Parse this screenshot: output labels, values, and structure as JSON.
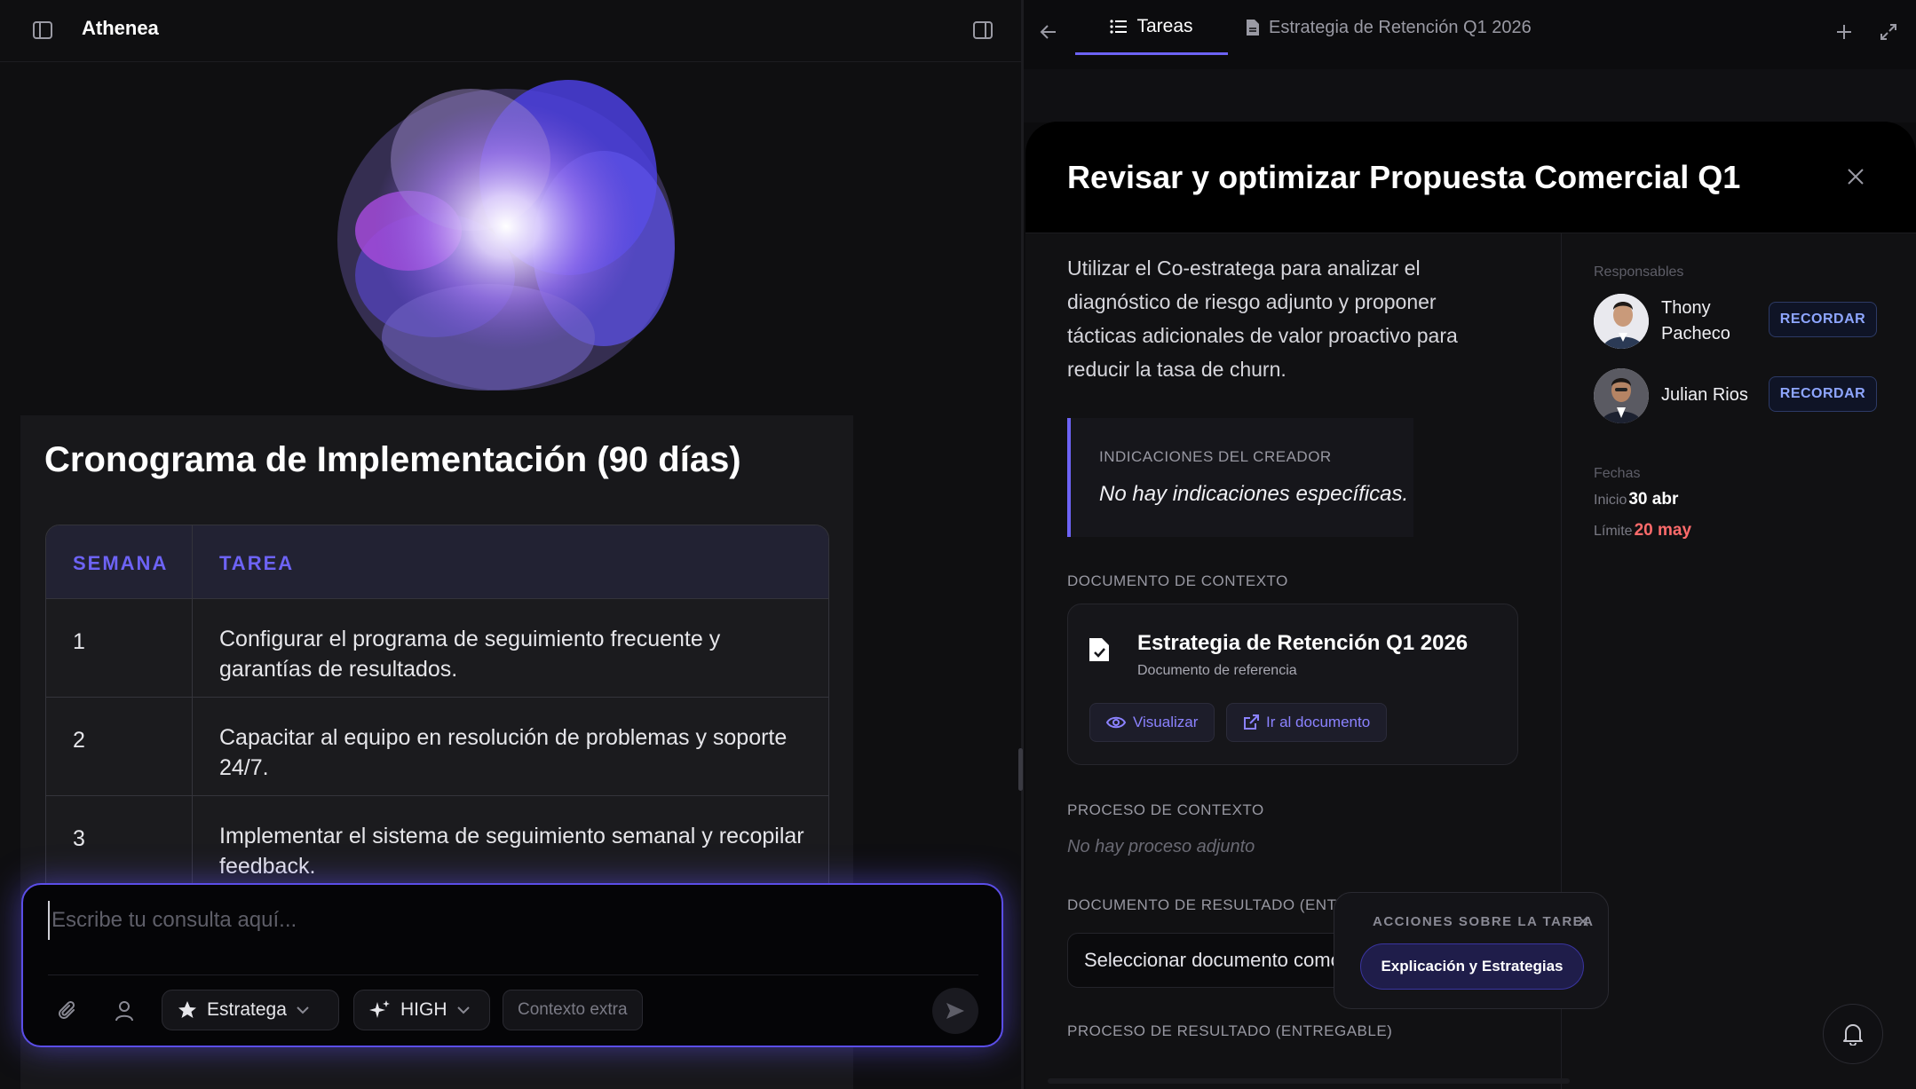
{
  "app": {
    "brand": "Athenea"
  },
  "chat": {
    "card_title": "Cronograma de Implementación (90 días)",
    "table": {
      "headers": [
        "SEMANA",
        "TAREA"
      ],
      "rows": [
        {
          "week": "1",
          "task": "Configurar el programa de seguimiento frecuente y garantías de resultados."
        },
        {
          "week": "2",
          "task": "Capacitar al equipo en resolución de problemas y soporte 24/7."
        },
        {
          "week": "3",
          "task": "Implementar el sistema de seguimiento semanal y recopilar feedback."
        }
      ]
    },
    "input": {
      "placeholder": "Escribe tu consulta aquí...",
      "value": ""
    },
    "mode": "Estratega",
    "level": "HIGH",
    "extra_context": "Contexto extra"
  },
  "right": {
    "tabs": [
      {
        "label": "Tareas",
        "icon": "list-icon"
      },
      {
        "label": "Estrategia de Retención Q1 2026",
        "icon": "file-icon"
      }
    ],
    "task": {
      "title": "Revisar y optimizar Propuesta Comercial Q1",
      "description": "Utilizar el Co-estratega para analizar el diagnóstico de riesgo adjunto y proponer tácticas adicionales de valor proactivo para reducir la tasa de churn.",
      "creator_label": "INDICACIONES DEL CREADOR",
      "creator_text": "No hay indicaciones específicas.",
      "context_doc_label": "DOCUMENTO DE CONTEXTO",
      "context_doc": {
        "title": "Estrategia de Retención Q1 2026",
        "subtitle": "Documento de referencia",
        "view_label": "Visualizar",
        "open_label": "Ir al documento"
      },
      "context_process_label": "PROCESO DE CONTEXTO",
      "context_process_empty": "No hay proceso adjunto",
      "result_doc_label": "DOCUMENTO DE RESULTADO (ENTREGABLE)",
      "result_doc_select": "Seleccionar documento como entregable",
      "result_process_label": "PROCESO DE RESULTADO (ENTREGABLE)"
    },
    "sidebar": {
      "responsables_label": "Responsables",
      "people": [
        {
          "name": "Thony Pacheco",
          "remind": "RECORDAR"
        },
        {
          "name": "Julian Rios",
          "remind": "RECORDAR"
        }
      ],
      "dates_label": "Fechas",
      "start_label": "Inicio",
      "start": "30 abr",
      "deadline_label": "Límite",
      "deadline": "20 may",
      "deadline_color": "#ff6b6b"
    },
    "actions": {
      "label": "ACCIONES SOBRE LA TAREA",
      "button": "Explicación y Estrategias"
    }
  },
  "colors": {
    "accent": "#6d63f5",
    "background": "#0d0d0f"
  }
}
